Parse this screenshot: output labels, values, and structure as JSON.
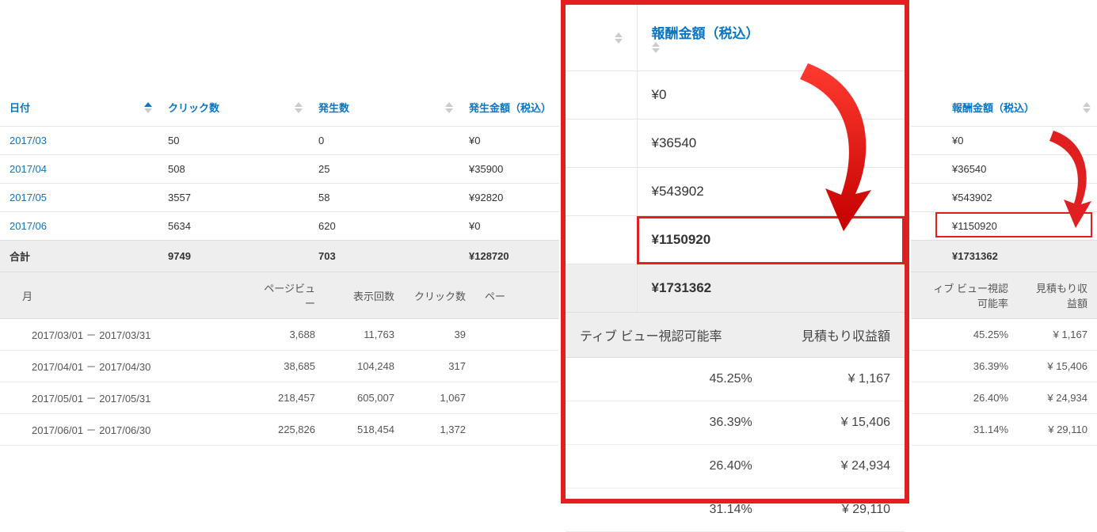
{
  "main": {
    "headers": {
      "date": "日付",
      "clicks": "クリック数",
      "occ": "発生数",
      "amount": "発生金額（税込）",
      "reward": "報酬金額（税込）"
    },
    "rows": [
      {
        "date": "2017/03",
        "clicks": "50",
        "occ": "0",
        "amount": "¥0",
        "reward": "¥0"
      },
      {
        "date": "2017/04",
        "clicks": "508",
        "occ": "25",
        "amount": "¥35900",
        "reward": "¥36540"
      },
      {
        "date": "2017/05",
        "clicks": "3557",
        "occ": "58",
        "amount": "¥92820",
        "reward": "¥543902"
      },
      {
        "date": "2017/06",
        "clicks": "5634",
        "occ": "620",
        "amount": "¥0",
        "reward": "¥1150920"
      }
    ],
    "totals": {
      "label": "合計",
      "clicks": "9749",
      "occ": "703",
      "amount": "¥128720",
      "reward": "¥1731362"
    }
  },
  "detail": {
    "headers": {
      "month": "月",
      "pv": "ページビュー",
      "imp": "表示回数",
      "cl": "クリック数",
      "gap": "ペー",
      "view": "ィブ ビュー視認可能率",
      "rev": "見積もり収益額"
    },
    "rows": [
      {
        "month": "2017/03/01 － 2017/03/31",
        "pv": "3,688",
        "imp": "11,763",
        "cl": "39",
        "view": "45.25%",
        "rev": "¥ 1,167"
      },
      {
        "month": "2017/04/01 － 2017/04/30",
        "pv": "38,685",
        "imp": "104,248",
        "cl": "317",
        "view": "36.39%",
        "rev": "¥ 15,406"
      },
      {
        "month": "2017/05/01 － 2017/05/31",
        "pv": "218,457",
        "imp": "605,007",
        "cl": "1,067",
        "view": "26.40%",
        "rev": "¥ 24,934"
      },
      {
        "month": "2017/06/01 － 2017/06/30",
        "pv": "225,826",
        "imp": "518,454",
        "cl": "1,372",
        "view": "31.14%",
        "rev": "¥ 29,110"
      }
    ]
  },
  "inset": {
    "header": "報酬金額（税込）",
    "values": [
      "¥0",
      "¥36540",
      "¥543902",
      "¥1150920"
    ],
    "total": "¥1731362",
    "bottom_headers": {
      "view": "ティブ ビュー視認可能率",
      "rev": "見積もり収益額"
    },
    "bottom_rows": [
      {
        "view": "45.25%",
        "rev": "¥ 1,167"
      },
      {
        "view": "36.39%",
        "rev": "¥ 15,406"
      },
      {
        "view": "26.40%",
        "rev": "¥ 24,934"
      },
      {
        "view": "31.14%",
        "rev": "¥ 29,110"
      }
    ]
  },
  "right": {
    "header": "報酬金額（税込）",
    "values": [
      "¥0",
      "¥36540",
      "¥543902",
      "¥1150920"
    ],
    "total": "¥1731362"
  }
}
